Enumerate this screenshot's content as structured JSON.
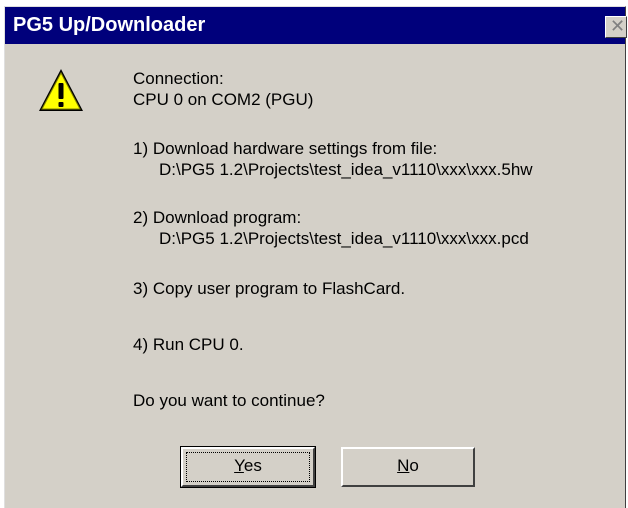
{
  "window": {
    "title": "PG5 Up/Downloader",
    "close_glyph": "✕"
  },
  "icon": "warning-icon",
  "message": {
    "connection_label": "Connection:",
    "connection_value": "CPU 0 on COM2 (PGU)",
    "step1": "1) Download hardware settings from file:",
    "step1_path": "D:\\PG5 1.2\\Projects\\test_idea_v1110\\xxx\\xxx.5hw",
    "step2": "2) Download program:",
    "step2_path": "D:\\PG5 1.2\\Projects\\test_idea_v1110\\xxx\\xxx.pcd",
    "step3": "3) Copy user program to FlashCard.",
    "step4": "4) Run CPU 0.",
    "question": "Do you want to continue?"
  },
  "buttons": {
    "yes_label": "Yes",
    "no_label": "No"
  },
  "colors": {
    "titlebar": "#00007b",
    "face": "#d4d0c8",
    "warning_fill": "#ffff00"
  }
}
